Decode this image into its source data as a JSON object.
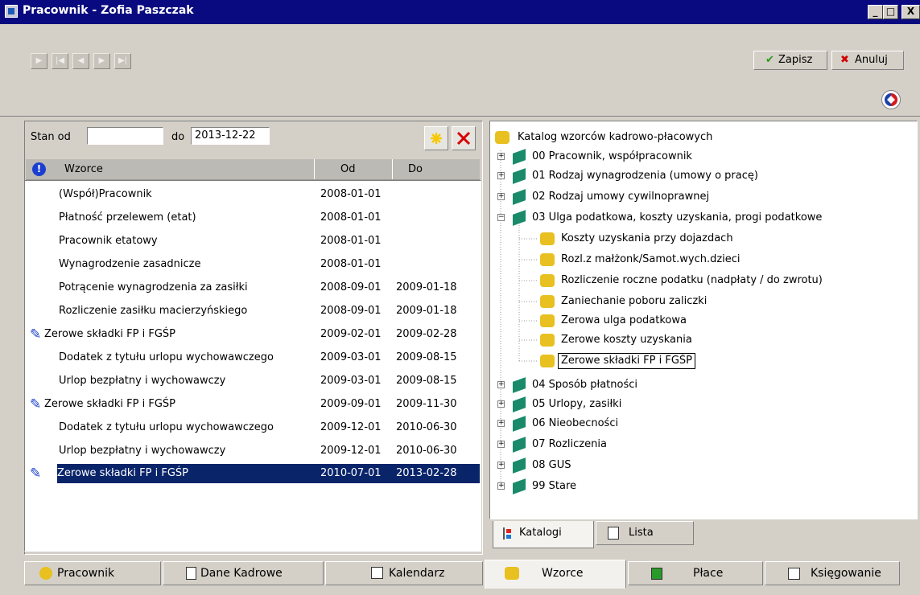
{
  "window": {
    "title": "Pracownik - Zofia Paszczak",
    "min": "_",
    "max": "□",
    "close": "X"
  },
  "toolbar": {
    "save_label": "Zapisz",
    "cancel_label": "Anuluj"
  },
  "filter": {
    "from_label": "Stan od",
    "from_value": "",
    "to_label": "do",
    "to_value": "2013-12-22"
  },
  "table": {
    "columns": [
      "Wzorce",
      "Od",
      "Do"
    ],
    "rows": [
      {
        "name": "(Współ)Pracownik",
        "from": "2008-01-01",
        "to": ""
      },
      {
        "name": "Płatność przelewem (etat)",
        "from": "2008-01-01",
        "to": ""
      },
      {
        "name": "Pracownik etatowy",
        "from": "2008-01-01",
        "to": ""
      },
      {
        "name": "Wynagrodzenie zasadnicze",
        "from": "2008-01-01",
        "to": ""
      },
      {
        "name": "Potrącenie wynagrodzenia za zasiłki",
        "from": "2008-09-01",
        "to": "2009-01-18"
      },
      {
        "name": "Rozliczenie zasiłku macierzyńskiego",
        "from": "2008-09-01",
        "to": "2009-01-18"
      },
      {
        "name": "Zerowe składki FP i FGŚP",
        "from": "2009-02-01",
        "to": "2009-02-28"
      },
      {
        "name": "Dodatek z tytułu urlopu wychowawczego",
        "from": "2009-03-01",
        "to": "2009-08-15"
      },
      {
        "name": "Urlop bezpłatny i wychowawczy",
        "from": "2009-03-01",
        "to": "2009-08-15"
      },
      {
        "name": "Zerowe składki FP i FGŚP",
        "from": "2009-09-01",
        "to": "2009-11-30"
      },
      {
        "name": "Dodatek z tytułu urlopu wychowawczego",
        "from": "2009-12-01",
        "to": "2010-06-30"
      },
      {
        "name": "Urlop bezpłatny i wychowawczy",
        "from": "2009-12-01",
        "to": "2010-06-30"
      },
      {
        "name": "Zerowe składki FP i FGŚP",
        "from": "2010-07-01",
        "to": "2013-02-28"
      }
    ]
  },
  "tree": {
    "root": "Katalog wzorców kadrowo-płacowych",
    "groups": [
      "00 Pracownik, współpracownik",
      "01 Rodzaj wynagrodzenia (umowy o pracę)",
      "02 Rodzaj umowy cywilnoprawnej",
      "03 Ulga podatkowa, koszty uzyskania, progi podatkowe",
      "04 Sposób płatności",
      "05 Urlopy, zasiłki",
      "06 Nieobecności",
      "07 Rozliczenia",
      "08 GUS",
      "99 Stare"
    ],
    "children": [
      "Koszty uzyskania przy dojazdach",
      "Rozl.z małżonk/Samot.wych.dzieci",
      "Rozliczenie roczne podatku (nadpłaty / do zwrotu)",
      "Zaniechanie poboru zaliczki",
      "Zerowa ulga podatkowa",
      "Zerowe koszty uzyskania",
      "Zerowe składki FP i FGŚP"
    ]
  },
  "inner_tabs": [
    "Katalogi",
    "Lista"
  ],
  "bottom_tabs": [
    "Pracownik",
    "Dane Kadrowe",
    "Kalendarz",
    "Wzorce",
    "Płace",
    "Księgowanie"
  ],
  "colors": {
    "title_bar": "#0a0a80",
    "selection": "#0a246a",
    "add_icon": "#f7c800",
    "delete_icon": "#d60000"
  }
}
